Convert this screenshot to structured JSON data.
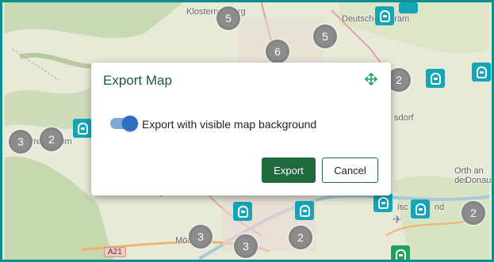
{
  "dialog": {
    "title": "Export Map",
    "toggle_label": "Export with visible map background",
    "toggle_on": true,
    "export_label": "Export",
    "cancel_label": "Cancel"
  },
  "map": {
    "clusters": [
      "5",
      "6",
      "5",
      "2",
      "3",
      "2",
      "3",
      "3",
      "2",
      "2"
    ],
    "places": [
      "Klosterneuburg",
      "Deutsch-Wagram",
      "Pressbaum",
      "sdorf",
      "Orth an der",
      "Donau",
      "isc",
      "nd",
      "Mödling"
    ],
    "road": "A21"
  },
  "colors": {
    "frame": "#0e8f8f",
    "accent": "#1f6b3e",
    "toggle": "#2e6fc2",
    "marker": "#14a6b8",
    "cluster": "#8c8c8c"
  }
}
